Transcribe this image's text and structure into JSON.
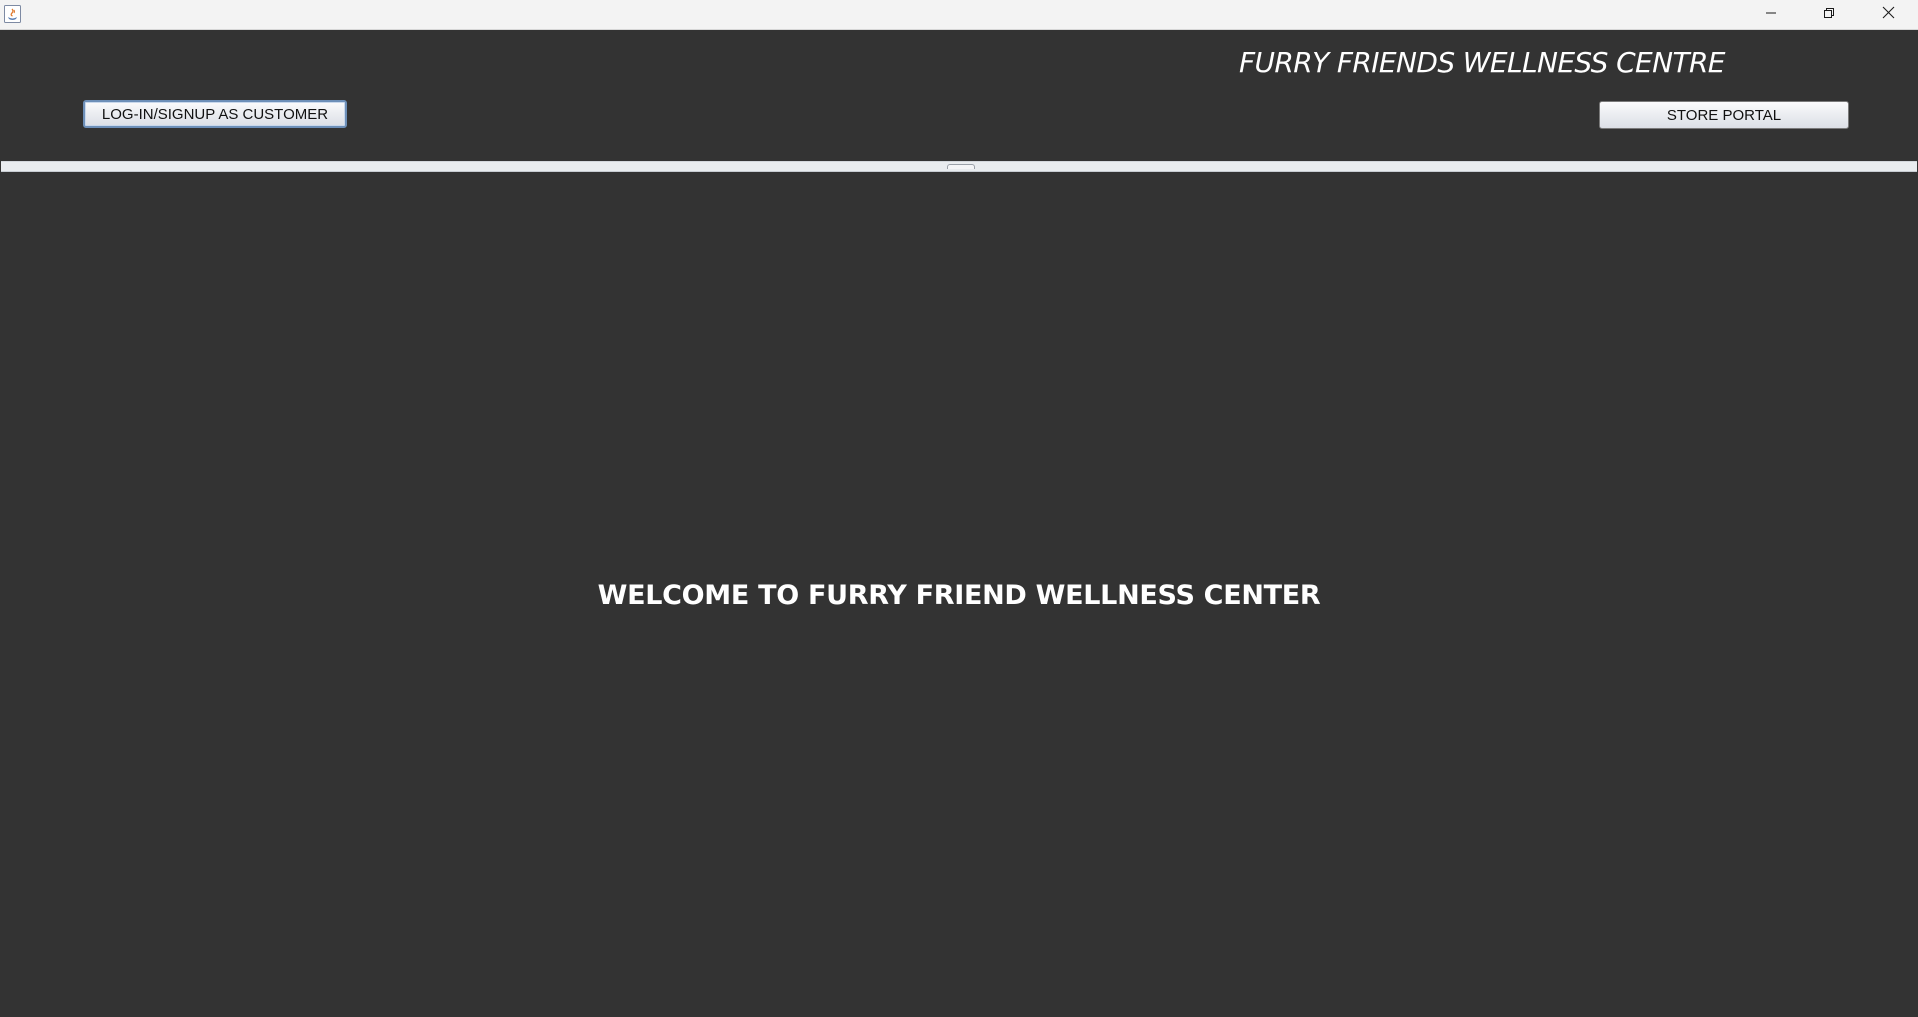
{
  "window": {
    "icon": "java-app-icon",
    "controls": {
      "minimize_icon": "minimize-icon",
      "restore_icon": "restore-icon",
      "close_icon": "close-icon"
    }
  },
  "header": {
    "title": "FURRY FRIENDS WELLNESS CENTRE",
    "customer_button_label": "LOG-IN/SIGNUP AS CUSTOMER",
    "store_button_label": "STORE PORTAL"
  },
  "main": {
    "welcome_text": "WELCOME TO FURRY FRIEND WELLNESS CENTER"
  },
  "colors": {
    "panel_background": "#333333",
    "title_bar": "#f3f3f3",
    "text": "#ffffff",
    "focus_border": "#6d8fb8"
  }
}
